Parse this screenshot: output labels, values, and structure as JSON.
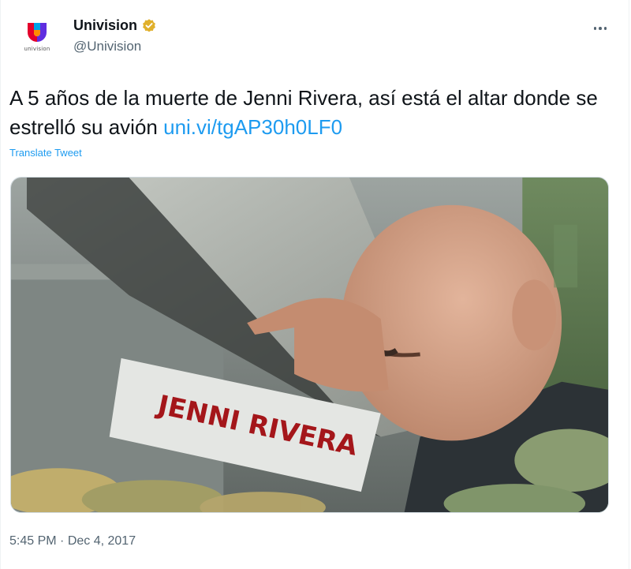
{
  "author": {
    "display_name": "Univision",
    "handle": "@Univision",
    "avatar_caption": "univision",
    "verified": true
  },
  "tweet": {
    "text_main": "A 5 años de la muerte de Jenni Rivera, así está el altar donde se estrelló su avión ",
    "link": "uni.vi/tgAP30h0LF0",
    "translate_label": "Translate Tweet"
  },
  "media": {
    "sign_text": "JENNI RIVERA"
  },
  "meta": {
    "time": "5:45 PM",
    "separator": " · ",
    "date": "Dec 4, 2017"
  },
  "colors": {
    "link": "#1d9bf0",
    "verified_badge": "#e0b02b",
    "secondary_text": "#536471",
    "sign_lettering": "#a4161a"
  },
  "icons": [
    "univision-logo-icon",
    "verified-badge-icon",
    "more-options-icon"
  ]
}
